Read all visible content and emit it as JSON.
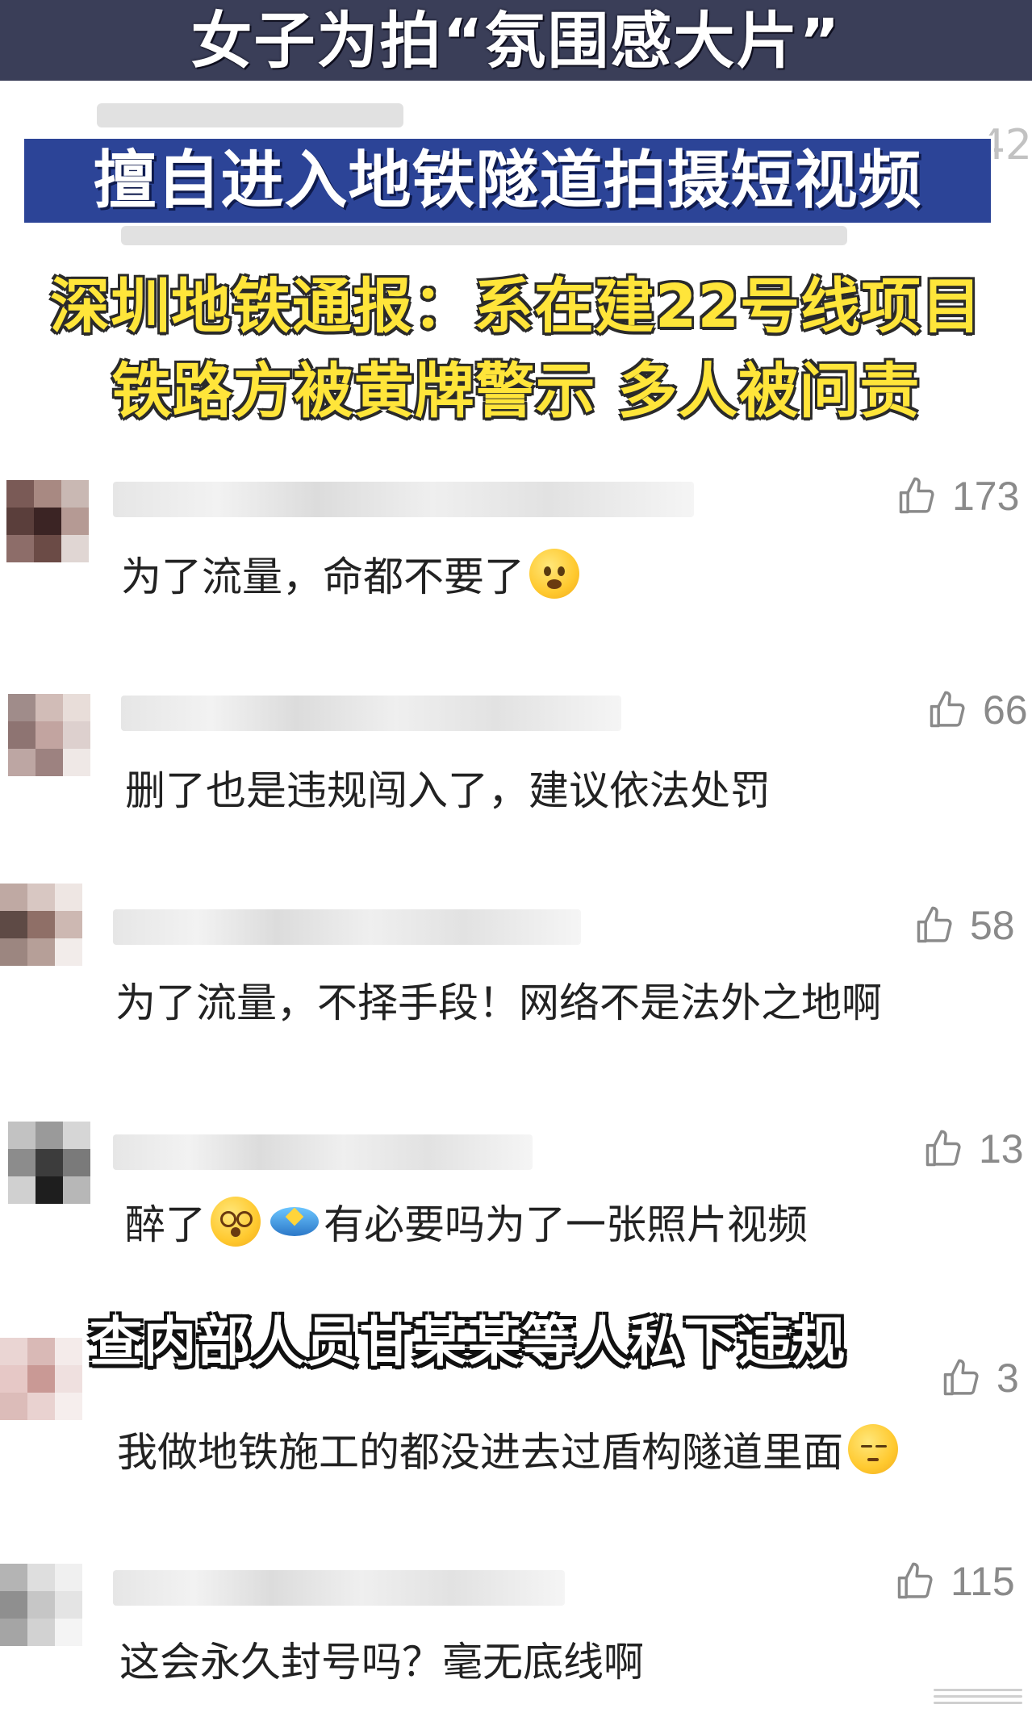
{
  "headline": {
    "line1": "女子为拍“氛围感大片”",
    "line2": "擅自进入地铁隧道拍摄短视频",
    "line3": "深圳地铁通报：系在建22号线项目",
    "line4": "铁路方被黄牌警示 多人被问责",
    "ghost_count": "42"
  },
  "overlay_caption": "查内部人员甘某某等人私下违规",
  "comments": [
    {
      "likes": "173",
      "text": "为了流量，命都不要了",
      "emoji": "scream-emoji"
    },
    {
      "likes": "66",
      "text": "删了也是违规闯入了，建议依法处罚"
    },
    {
      "likes": "58",
      "text": "为了流量，不择手段！网络不是法外之地啊"
    },
    {
      "likes": "13",
      "text_before": "醉了",
      "text_after": "有必要吗为了一张照片视频",
      "emoji": "dizzy-emoji"
    },
    {
      "likes": "3",
      "text": "我做地铁施工的都没进去过盾构隧道里面",
      "emoji": "sweat-emoji"
    },
    {
      "likes": "115",
      "text": "这会永久封号吗？毫无底线啊"
    }
  ],
  "colors": {
    "topbar": "#3a3e58",
    "headline_box": "#2c4497",
    "headline_yellow": "#ffe53a",
    "like_gray": "#8a8a8a",
    "text": "#222222"
  },
  "icons": [
    "thumbs-up-icon",
    "scream-emoji",
    "dizzy-emoji",
    "ufo-emoji",
    "sweat-emoji"
  ]
}
